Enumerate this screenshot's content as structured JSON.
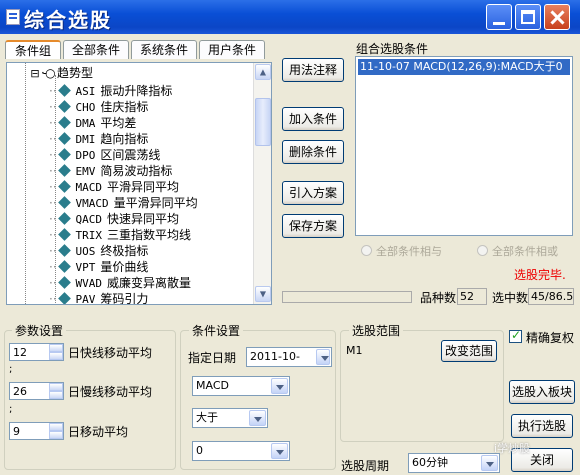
{
  "window": {
    "title": "综合选股"
  },
  "tabs": [
    {
      "label": "条件组",
      "active": true
    },
    {
      "label": "全部条件"
    },
    {
      "label": "系统条件"
    },
    {
      "label": "用户条件"
    }
  ],
  "tree": {
    "group_label": "趋势型",
    "items": [
      {
        "code": "ASI",
        "name": "振动升降指标"
      },
      {
        "code": "CHO",
        "name": "佳庆指标"
      },
      {
        "code": "DMA",
        "name": "平均差"
      },
      {
        "code": "DMI",
        "name": "趋向指标"
      },
      {
        "code": "DPO",
        "name": "区间震荡线"
      },
      {
        "code": "EMV",
        "name": "简易波动指标"
      },
      {
        "code": "MACD",
        "name": "平滑异同平均",
        "selected": true
      },
      {
        "code": "VMACD",
        "name": "量平滑异同平均"
      },
      {
        "code": "QACD",
        "name": "快速异同平均"
      },
      {
        "code": "TRIX",
        "name": "三重指数平均线"
      },
      {
        "code": "UOS",
        "name": "终极指标"
      },
      {
        "code": "VPT",
        "name": "量价曲线"
      },
      {
        "code": "WVAD",
        "name": "威廉变异离散量"
      },
      {
        "code": "PAV",
        "name": "筹码引力"
      }
    ]
  },
  "buttons": {
    "usage": "用法注释",
    "add_condition": "加入条件",
    "delete_condition": "删除条件",
    "import_plan": "引入方案",
    "save_plan": "保存方案",
    "change_range": "改变范围",
    "add_to_board": "选股入板块",
    "execute": "执行选股",
    "close": "关闭"
  },
  "combo_conditions": {
    "label": "组合选股条件",
    "items": [
      "11-10-07 MACD(12,26,9):MACD大于0"
    ]
  },
  "logic": {
    "all_and": "全部条件相与",
    "all_or": "全部条件相或"
  },
  "status": {
    "done": "选股完毕.",
    "variety_label": "品种数",
    "variety_value": "52",
    "selected_label": "选中数",
    "selected_value": "45/86.5"
  },
  "params": {
    "label": "参数设置",
    "rows": [
      {
        "value": "12",
        "label": "日快线移动平均"
      },
      {
        "value": "26",
        "label": "日慢线移动平均"
      },
      {
        "value": "9",
        "label": "日移动平均"
      }
    ]
  },
  "condition_settings": {
    "label": "条件设置",
    "date_label": "指定日期",
    "date_value": "2011-10-",
    "indicator_value": "MACD",
    "compare_value": "大于",
    "threshold_value": "0"
  },
  "range": {
    "label": "选股范围",
    "value": "M1"
  },
  "accurate_restore": {
    "label": "精确复权",
    "checked": true
  },
  "period": {
    "label": "选股周期",
    "value": "60分钟"
  },
  "watermark": "i学炒股"
}
